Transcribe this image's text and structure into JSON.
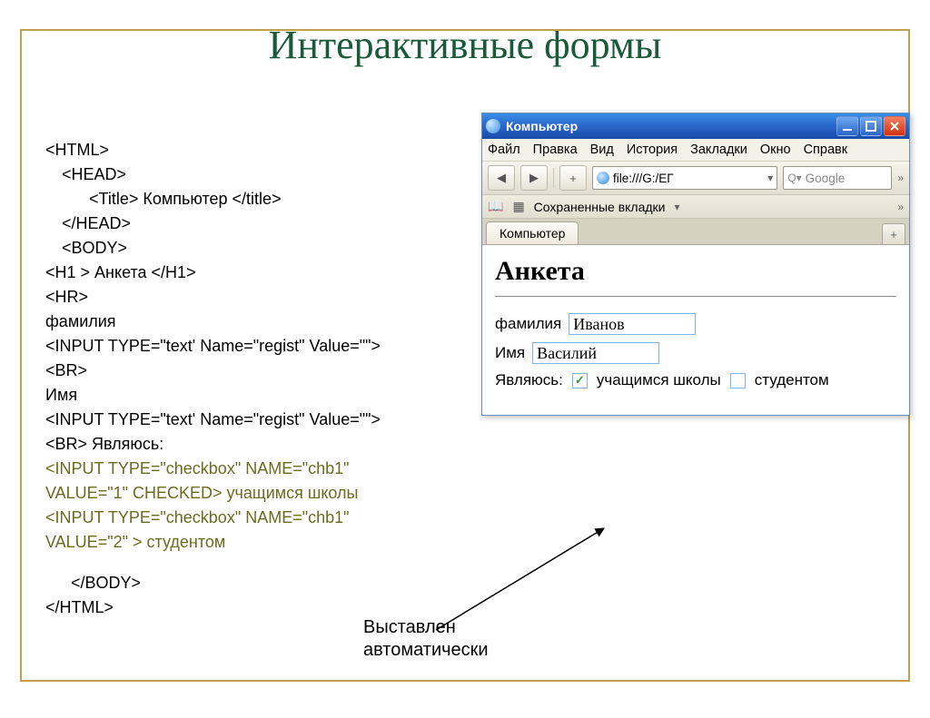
{
  "slide": {
    "title": "Интерактивные формы",
    "footer_line1": "Выставлен",
    "footer_line2": "автоматически"
  },
  "code": {
    "l1": "<HTML>",
    "l2": "<HEAD>",
    "l3_a": "<Title>",
    "l3_b": " Компьютер ",
    "l3_c": "</title>",
    "l4": "</HEAD>",
    "l5": "<BODY>",
    "l6_a": "<H1 >",
    "l6_b": " Анкета ",
    "l6_c": "</H1>",
    "l7": "<HR>",
    "l8": "фамилия",
    "l9": "<INPUT TYPE=\"text' Name=\"regist\" Value=\"\">",
    "l10": "<BR>",
    "l11": "Имя",
    "l12": "<INPUT TYPE=\"text' Name=\"regist\" Value=\"\">",
    "l13_a": "<BR>",
    "l13_b": " Являюсь:",
    "l14": "<INPUT TYPE=\"checkbox\" NAME=\"chb1\" VALUE=\"1\" CHECKED>",
    "l14_b": " учащимся школы",
    "l15": "<INPUT TYPE=\"checkbox\" NAME=\"chb1\" VALUE=\"2\" >",
    "l15_b": " студентом",
    "l16": "</BODY>",
    "l17": "</HTML>"
  },
  "browser": {
    "window_title": "Компьютер",
    "menu": [
      "Файл",
      "Правка",
      "Вид",
      "История",
      "Закладки",
      "Окно",
      "Справк"
    ],
    "url": "file:///G:/ЕГ",
    "search_placeholder": "Google",
    "bookbar_label": "Сохраненные вкладки",
    "tab_label": "Компьютер",
    "page": {
      "h1": "Анкета",
      "surname_label": "фамилия",
      "surname_value": "Иванов",
      "name_label": "Имя",
      "name_value": "Василий",
      "role_label": "Являюсь:",
      "opt1": "учащимся школы",
      "opt2": "студентом"
    }
  }
}
